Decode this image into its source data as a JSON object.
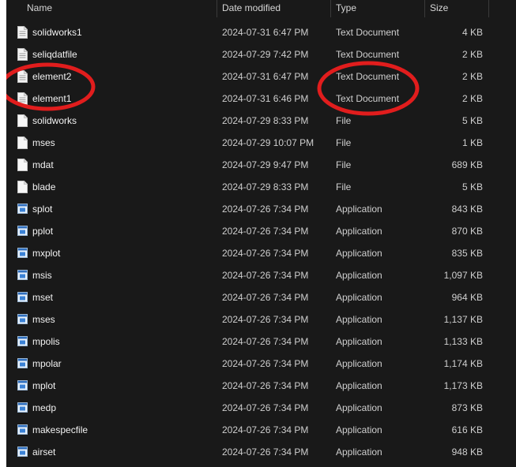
{
  "columns": {
    "name": "Name",
    "date_modified": "Date modified",
    "type": "Type",
    "size": "Size"
  },
  "rows": [
    {
      "name": "solidworks1",
      "date": "2024-07-31 6:47 PM",
      "type": "Text Document",
      "size": "4 KB",
      "icon": "text-document-icon"
    },
    {
      "name": "seliqdatfile",
      "date": "2024-07-29 7:42 PM",
      "type": "Text Document",
      "size": "2 KB",
      "icon": "text-document-icon"
    },
    {
      "name": "element2",
      "date": "2024-07-31 6:47 PM",
      "type": "Text Document",
      "size": "2 KB",
      "icon": "text-document-icon"
    },
    {
      "name": "element1",
      "date": "2024-07-31 6:46 PM",
      "type": "Text Document",
      "size": "2 KB",
      "icon": "text-document-icon"
    },
    {
      "name": "solidworks",
      "date": "2024-07-29 8:33 PM",
      "type": "File",
      "size": "5 KB",
      "icon": "file-icon"
    },
    {
      "name": "mses",
      "date": "2024-07-29 10:07 PM",
      "type": "File",
      "size": "1 KB",
      "icon": "file-icon"
    },
    {
      "name": "mdat",
      "date": "2024-07-29 9:47 PM",
      "type": "File",
      "size": "689 KB",
      "icon": "file-icon"
    },
    {
      "name": "blade",
      "date": "2024-07-29 8:33 PM",
      "type": "File",
      "size": "5 KB",
      "icon": "file-icon"
    },
    {
      "name": "splot",
      "date": "2024-07-26 7:34 PM",
      "type": "Application",
      "size": "843 KB",
      "icon": "application-icon"
    },
    {
      "name": "pplot",
      "date": "2024-07-26 7:34 PM",
      "type": "Application",
      "size": "870 KB",
      "icon": "application-icon"
    },
    {
      "name": "mxplot",
      "date": "2024-07-26 7:34 PM",
      "type": "Application",
      "size": "835 KB",
      "icon": "application-icon"
    },
    {
      "name": "msis",
      "date": "2024-07-26 7:34 PM",
      "type": "Application",
      "size": "1,097 KB",
      "icon": "application-icon"
    },
    {
      "name": "mset",
      "date": "2024-07-26 7:34 PM",
      "type": "Application",
      "size": "964 KB",
      "icon": "application-icon"
    },
    {
      "name": "mses",
      "date": "2024-07-26 7:34 PM",
      "type": "Application",
      "size": "1,137 KB",
      "icon": "application-icon"
    },
    {
      "name": "mpolis",
      "date": "2024-07-26 7:34 PM",
      "type": "Application",
      "size": "1,133 KB",
      "icon": "application-icon"
    },
    {
      "name": "mpolar",
      "date": "2024-07-26 7:34 PM",
      "type": "Application",
      "size": "1,174 KB",
      "icon": "application-icon"
    },
    {
      "name": "mplot",
      "date": "2024-07-26 7:34 PM",
      "type": "Application",
      "size": "1,173 KB",
      "icon": "application-icon"
    },
    {
      "name": "medp",
      "date": "2024-07-26 7:34 PM",
      "type": "Application",
      "size": "873 KB",
      "icon": "application-icon"
    },
    {
      "name": "makespecfile",
      "date": "2024-07-26 7:34 PM",
      "type": "Application",
      "size": "616 KB",
      "icon": "application-icon"
    },
    {
      "name": "airset",
      "date": "2024-07-26 7:34 PM",
      "type": "Application",
      "size": "948 KB",
      "icon": "application-icon"
    }
  ],
  "colors": {
    "background": "#191919",
    "annotation": "#e11d1d"
  }
}
